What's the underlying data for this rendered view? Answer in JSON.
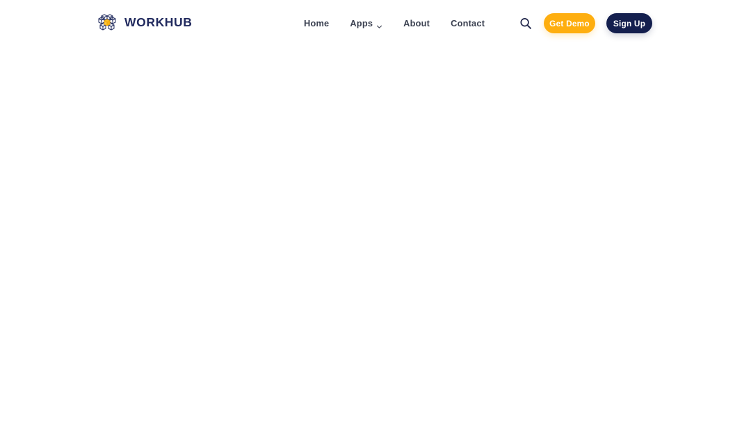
{
  "site": {
    "brand_name": "WORKHUB",
    "logo_icon": "cube-logo-icon",
    "colors": {
      "navy": "#141f4e",
      "brand_text": "#212a5e",
      "amber": "#feae0f",
      "nav_text": "#3b4151",
      "background": "#ffffff"
    }
  },
  "header": {
    "nav": [
      {
        "label": "Home",
        "has_dropdown": false
      },
      {
        "label": "Apps",
        "has_dropdown": true,
        "dropdown_icon": "chevron-down-icon"
      },
      {
        "label": "About",
        "has_dropdown": false
      },
      {
        "label": "Contact",
        "has_dropdown": false
      }
    ],
    "search_icon": "search-icon",
    "buttons": {
      "demo_label": "Get Demo",
      "signup_label": "Sign Up"
    }
  },
  "body": {
    "content": ""
  }
}
